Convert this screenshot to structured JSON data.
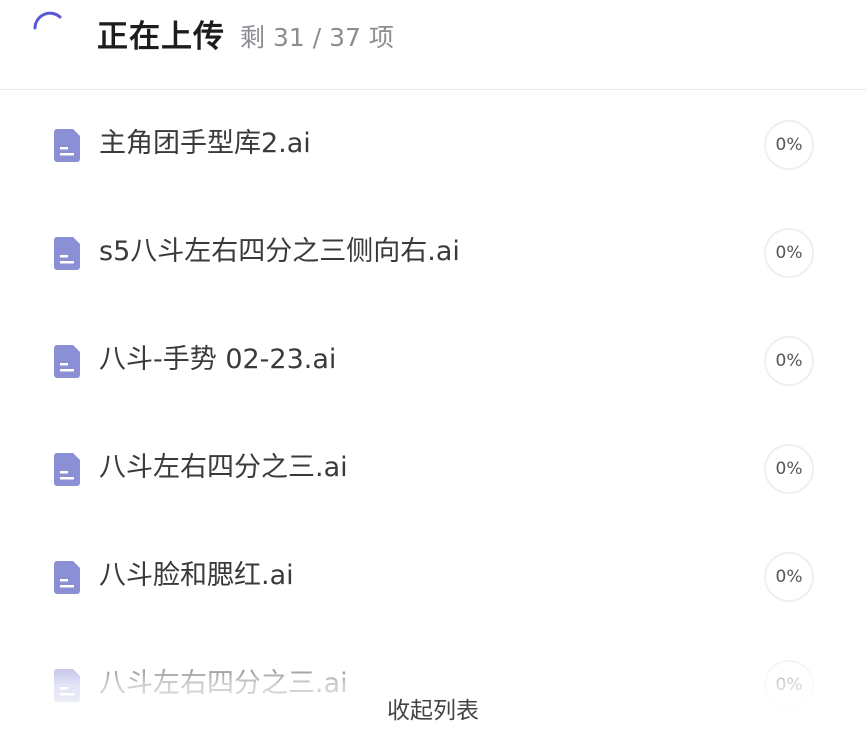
{
  "header": {
    "title": "正在上传",
    "remaining": "剩 31 / 37 项"
  },
  "colors": {
    "accent": "#5b57d9",
    "file_icon": "#8b8fd6"
  },
  "files": [
    {
      "name": "主角团手型库2.ai",
      "progress": "0%",
      "icon": "document-icon"
    },
    {
      "name": "s5八斗左右四分之三侧向右.ai",
      "progress": "0%",
      "icon": "document-icon"
    },
    {
      "name": "八斗-手势 02-23.ai",
      "progress": "0%",
      "icon": "document-icon"
    },
    {
      "name": "八斗左右四分之三.ai",
      "progress": "0%",
      "icon": "document-icon"
    },
    {
      "name": "八斗脸和腮红.ai",
      "progress": "0%",
      "icon": "document-icon"
    },
    {
      "name": "八斗左右四分之三.ai",
      "progress": "0%",
      "icon": "document-icon"
    }
  ],
  "footer": {
    "collapse_label": "收起列表"
  }
}
